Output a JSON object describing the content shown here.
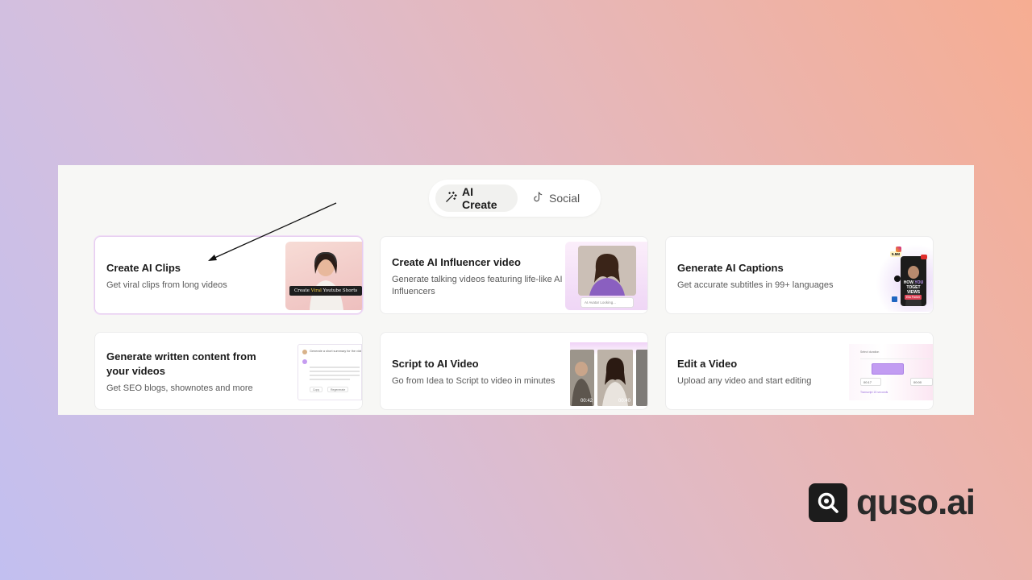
{
  "tabs": [
    {
      "label": "AI Create",
      "icon": "magic-wand-icon",
      "active": true
    },
    {
      "label": "Social",
      "icon": "tiktok-icon",
      "active": false
    }
  ],
  "cards": [
    {
      "title": "Create AI Clips",
      "desc": "Get viral clips from long videos",
      "thumb_caption_a": "Create ",
      "thumb_caption_b": "Viral",
      "thumb_caption_c": " Youtube Shorts"
    },
    {
      "title": "Create AI Influencer video",
      "desc": "Generate talking videos featuring life-like AI Influencers",
      "thumb_input": "AI Avatar Looking..."
    },
    {
      "title": "Generate AI Captions",
      "desc": "Get accurate subtitles in 99+ languages",
      "thumb_badge": "5.5M",
      "thumb_caption_a": "HOW",
      "thumb_caption_b": "YOU",
      "thumb_caption_c": "TOGET VIEWS",
      "thumb_tag": "Ella Parker"
    },
    {
      "title": "Generate written content from your videos",
      "desc": "Get SEO blogs, shownotes and more",
      "thumb_line": "Generate a short summary for the video",
      "thumb_btn_a": "Copy",
      "thumb_btn_b": "Regenerate"
    },
    {
      "title": "Script to AI Video",
      "desc": "Go from Idea to Script to video in minutes",
      "thumb_time_a": "00:42",
      "thumb_time_b": "00:40"
    },
    {
      "title": "Edit a Video",
      "desc": "Upload any video and start editing",
      "thumb_label": "Select duration",
      "thumb_val_a": "00:17",
      "thumb_val_b": "00:00",
      "thumb_hint": "Transcript 15 seconds"
    }
  ],
  "logo": {
    "text": "quso.ai",
    "icon": "quso-logo-icon"
  },
  "colors": {
    "accent": "#c99cf0",
    "dark": "#1c1c1c"
  }
}
